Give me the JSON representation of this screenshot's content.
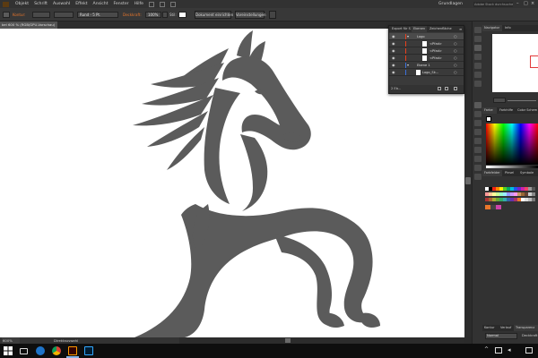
{
  "menu": {
    "items": [
      "Objekt",
      "Schrift",
      "Auswahl",
      "Effekt",
      "Ansicht",
      "Fenster",
      "Hilfe"
    ],
    "workspace": "Grundlagen",
    "search_placeholder": "Adobe Stock durchsuchen"
  },
  "control_bar": {
    "stroke_label": "Kontur:",
    "brush_value": "Rund - 5 Pt.",
    "opacity_label": "Deckkraft:",
    "opacity_value": "100%",
    "style_label": "Stil:",
    "doc_setup_button": "Dokument einrichten",
    "preferences_button": "Voreinstellungen"
  },
  "document_tab": {
    "label": "bei 600 % (RGB/GPU-Vorschau)"
  },
  "layers_panel": {
    "tabs": [
      "Export für S",
      "Ebenen",
      "Zeichenfläche"
    ],
    "rows": [
      {
        "name": "Logo",
        "level": 0
      },
      {
        "name": "<Pfad>",
        "level": 1
      },
      {
        "name": "<Pfad>",
        "level": 1
      },
      {
        "name": "<Pfad>",
        "level": 1
      },
      {
        "name": "Ebene 1",
        "level": 0
      },
      {
        "name": "Logo_Sk...",
        "level": 1
      }
    ],
    "footer": "2 Eb..."
  },
  "status": {
    "zoom": "600%",
    "tool": "Direktauswahl"
  },
  "right_panel": {
    "navigator_tabs": [
      "Navigator",
      "Info"
    ],
    "color_tabs": [
      "Farbe",
      "Farbhilfe",
      "Color Schem"
    ],
    "swatch_tabs": [
      "Farbfelder",
      "Pinsel",
      "Symbole"
    ],
    "bottom_tabs": [
      "Kontur",
      "Verlauf",
      "Transparenz"
    ],
    "blend_mode": "Normal",
    "opacity_label": "Deckkraft"
  },
  "colors": {
    "accent": "#e8762b",
    "horse": "#5b5b5b",
    "selection_blue": "#3b6fd9"
  }
}
